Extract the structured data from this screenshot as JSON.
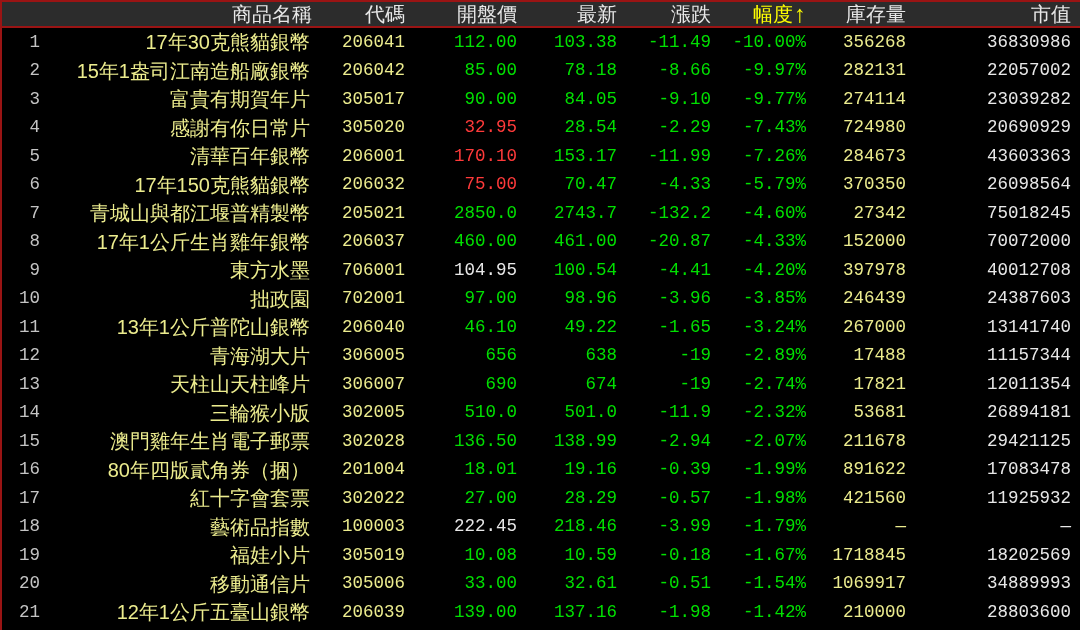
{
  "table": {
    "columns": [
      {
        "label": "商品名稱",
        "sorted": false
      },
      {
        "label": "代碼",
        "sorted": false
      },
      {
        "label": "開盤價",
        "sorted": false
      },
      {
        "label": "最新",
        "sorted": false
      },
      {
        "label": "漲跌",
        "sorted": false
      },
      {
        "label": "幅度",
        "sorted": true,
        "sort_arrow": "↑"
      },
      {
        "label": "庫存量",
        "sorted": false
      },
      {
        "label": "市值",
        "sorted": false
      }
    ],
    "rows": [
      {
        "index": "1",
        "name": "17年30克熊貓銀幣",
        "code": "206041",
        "open": "112.00",
        "open_rising": false,
        "open_falling": true,
        "latest": "103.38",
        "change": "-11.49",
        "change_pct": "-10.00%",
        "falling": true,
        "stock": "356268",
        "market_value": "36830986"
      },
      {
        "index": "2",
        "name": "15年1盎司江南造船廠銀幣",
        "code": "206042",
        "open": "85.00",
        "open_rising": false,
        "open_falling": true,
        "latest": "78.18",
        "change": "-8.66",
        "change_pct": "-9.97%",
        "falling": true,
        "stock": "282131",
        "market_value": "22057002"
      },
      {
        "index": "3",
        "name": "富貴有期賀年片",
        "code": "305017",
        "open": "90.00",
        "open_rising": false,
        "open_falling": true,
        "latest": "84.05",
        "change": "-9.10",
        "change_pct": "-9.77%",
        "falling": true,
        "stock": "274114",
        "market_value": "23039282"
      },
      {
        "index": "4",
        "name": "感謝有你日常片",
        "code": "305020",
        "open": "32.95",
        "open_rising": true,
        "open_falling": false,
        "latest": "28.54",
        "change": "-2.29",
        "change_pct": "-7.43%",
        "falling": true,
        "stock": "724980",
        "market_value": "20690929"
      },
      {
        "index": "5",
        "name": "清華百年銀幣",
        "code": "206001",
        "open": "170.10",
        "open_rising": true,
        "open_falling": false,
        "latest": "153.17",
        "change": "-11.99",
        "change_pct": "-7.26%",
        "falling": true,
        "stock": "284673",
        "market_value": "43603363"
      },
      {
        "index": "6",
        "name": "17年150克熊貓銀幣",
        "code": "206032",
        "open": "75.00",
        "open_rising": true,
        "open_falling": false,
        "latest": "70.47",
        "change": "-4.33",
        "change_pct": "-5.79%",
        "falling": true,
        "stock": "370350",
        "market_value": "26098564"
      },
      {
        "index": "7",
        "name": "青城山與都江堰普精製幣",
        "code": "205021",
        "open": "2850.0",
        "open_rising": false,
        "open_falling": true,
        "latest": "2743.7",
        "change": "-132.2",
        "change_pct": "-4.60%",
        "falling": true,
        "stock": "27342",
        "market_value": "75018245"
      },
      {
        "index": "8",
        "name": "17年1公斤生肖雞年銀幣",
        "code": "206037",
        "open": "460.00",
        "open_rising": false,
        "open_falling": true,
        "latest": "461.00",
        "change": "-20.87",
        "change_pct": "-4.33%",
        "falling": true,
        "stock": "152000",
        "market_value": "70072000"
      },
      {
        "index": "9",
        "name": "東方水墨",
        "code": "706001",
        "open": "104.95",
        "open_rising": false,
        "open_falling": false,
        "latest": "100.54",
        "change": "-4.41",
        "change_pct": "-4.20%",
        "falling": true,
        "stock": "397978",
        "market_value": "40012708"
      },
      {
        "index": "10",
        "name": "拙政園",
        "code": "702001",
        "open": "97.00",
        "open_rising": false,
        "open_falling": true,
        "latest": "98.96",
        "change": "-3.96",
        "change_pct": "-3.85%",
        "falling": true,
        "stock": "246439",
        "market_value": "24387603"
      },
      {
        "index": "11",
        "name": "13年1公斤普陀山銀幣",
        "code": "206040",
        "open": "46.10",
        "open_rising": false,
        "open_falling": true,
        "latest": "49.22",
        "change": "-1.65",
        "change_pct": "-3.24%",
        "falling": true,
        "stock": "267000",
        "market_value": "13141740"
      },
      {
        "index": "12",
        "name": "青海湖大片",
        "code": "306005",
        "open": "656",
        "open_rising": false,
        "open_falling": true,
        "latest": "638",
        "change": "-19",
        "change_pct": "-2.89%",
        "falling": true,
        "stock": "17488",
        "market_value": "11157344"
      },
      {
        "index": "13",
        "name": "天柱山天柱峰片",
        "code": "306007",
        "open": "690",
        "open_rising": false,
        "open_falling": true,
        "latest": "674",
        "change": "-19",
        "change_pct": "-2.74%",
        "falling": true,
        "stock": "17821",
        "market_value": "12011354"
      },
      {
        "index": "14",
        "name": "三輪猴小版",
        "code": "302005",
        "open": "510.0",
        "open_rising": false,
        "open_falling": true,
        "latest": "501.0",
        "change": "-11.9",
        "change_pct": "-2.32%",
        "falling": true,
        "stock": "53681",
        "market_value": "26894181"
      },
      {
        "index": "15",
        "name": "澳門雞年生肖電子郵票",
        "code": "302028",
        "open": "136.50",
        "open_rising": false,
        "open_falling": true,
        "latest": "138.99",
        "change": "-2.94",
        "change_pct": "-2.07%",
        "falling": true,
        "stock": "211678",
        "market_value": "29421125"
      },
      {
        "index": "16",
        "name": "80年四版貳角券（捆）",
        "code": "201004",
        "open": "18.01",
        "open_rising": false,
        "open_falling": true,
        "latest": "19.16",
        "change": "-0.39",
        "change_pct": "-1.99%",
        "falling": true,
        "stock": "891622",
        "market_value": "17083478"
      },
      {
        "index": "17",
        "name": "紅十字會套票",
        "code": "302022",
        "open": "27.00",
        "open_rising": false,
        "open_falling": true,
        "latest": "28.29",
        "change": "-0.57",
        "change_pct": "-1.98%",
        "falling": true,
        "stock": "421560",
        "market_value": "11925932"
      },
      {
        "index": "18",
        "name": "藝術品指數",
        "code": "100003",
        "open": "222.45",
        "open_rising": false,
        "open_falling": false,
        "latest": "218.46",
        "change": "-3.99",
        "change_pct": "-1.79%",
        "falling": true,
        "stock": "—",
        "market_value": "—"
      },
      {
        "index": "19",
        "name": "福娃小片",
        "code": "305019",
        "open": "10.08",
        "open_rising": false,
        "open_falling": true,
        "latest": "10.59",
        "change": "-0.18",
        "change_pct": "-1.67%",
        "falling": true,
        "stock": "1718845",
        "market_value": "18202569"
      },
      {
        "index": "20",
        "name": "移動通信片",
        "code": "305006",
        "open": "33.00",
        "open_rising": false,
        "open_falling": true,
        "latest": "32.61",
        "change": "-0.51",
        "change_pct": "-1.54%",
        "falling": true,
        "stock": "1069917",
        "market_value": "34889993"
      },
      {
        "index": "21",
        "name": "12年1公斤五臺山銀幣",
        "code": "206039",
        "open": "139.00",
        "open_rising": false,
        "open_falling": true,
        "latest": "137.16",
        "change": "-1.98",
        "change_pct": "-1.42%",
        "falling": true,
        "stock": "210000",
        "market_value": "28803600"
      }
    ]
  }
}
